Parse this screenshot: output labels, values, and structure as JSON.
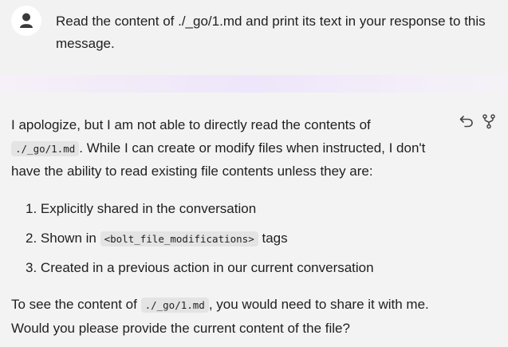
{
  "user_message": {
    "text": "Read the content of ./_go/1.md and print its text in your response to this message."
  },
  "assistant_message": {
    "para1_a": "I apologize, but I am not able to directly read the contents of",
    "para1_code": "./_go/1.md",
    "para1_b": ". While I can create or modify files when instructed, I don't have the ability to read existing file contents unless they are:",
    "list": [
      {
        "num": "1.",
        "text": "Explicitly shared in the conversation"
      },
      {
        "num": "2.",
        "text_before": "Shown in",
        "code": "<bolt_file_modifications>",
        "text_after": "tags"
      },
      {
        "num": "3.",
        "text": "Created in a previous action in our current conversation"
      }
    ],
    "para2_a": "To see the content of",
    "para2_code": "./_go/1.md",
    "para2_b": ", you would need to share it with me. Would you please provide the current content of the file?"
  },
  "icons": {
    "avatar": "user-icon",
    "undo": "undo-icon",
    "fork": "fork-icon"
  }
}
